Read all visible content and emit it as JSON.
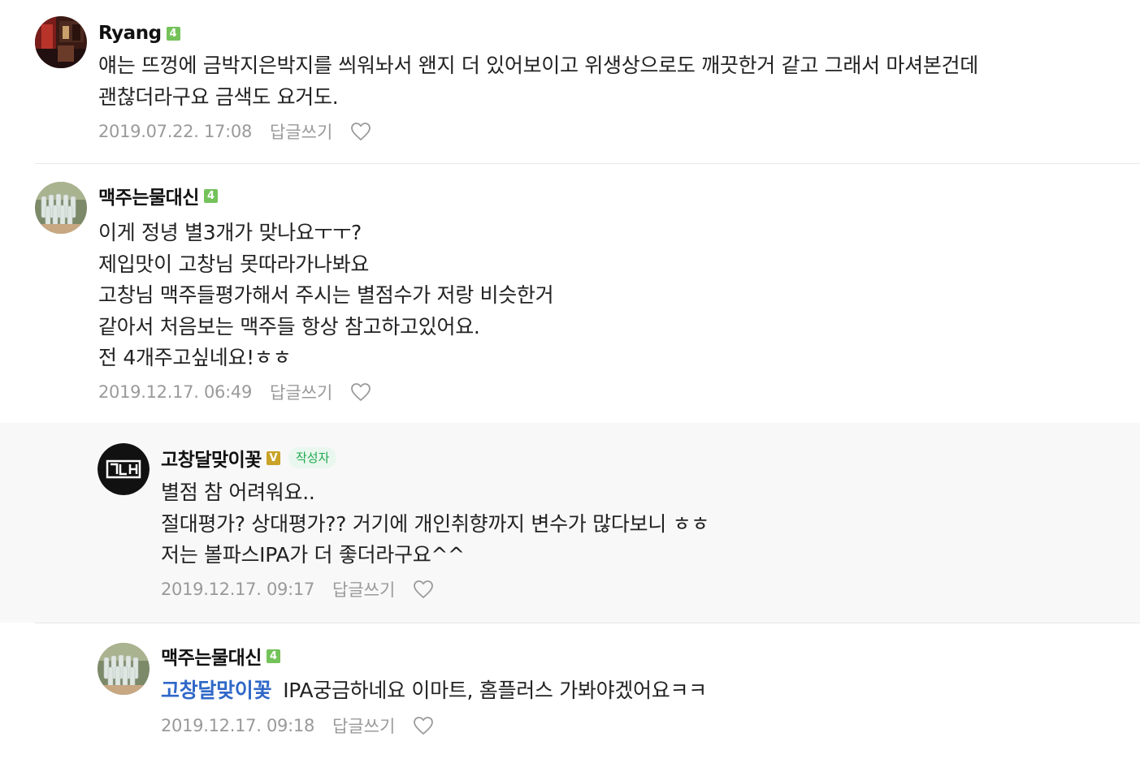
{
  "comments": [
    {
      "nickname": "Ryang",
      "level": "4",
      "lines": [
        "얘는 뜨껑에 금박지은박지를 씌워놔서 왠지 더 있어보이고 위생상으로도 깨끗한거 같고 그래서 마셔본건데",
        "괜찮더라구요 금색도 요거도."
      ],
      "date": "2019.07.22. 17:08",
      "reply_label": "답글쓰기"
    },
    {
      "nickname": "맥주는물대신",
      "level": "4",
      "lines": [
        "이게 정녕 별3개가 맞나요ㅜㅜ?",
        "제입맛이 고창님 못따라가나봐요",
        "고창님 맥주들평가해서 주시는 별점수가 저랑 비슷한거",
        "같아서 처음보는 맥주들 항상 참고하고있어요.",
        "전 4개주고싶네요!ㅎㅎ"
      ],
      "date": "2019.12.17. 06:49",
      "reply_label": "답글쓰기"
    },
    {
      "nickname": "고창달맞이꽃",
      "level": "V",
      "author_tag": "작성자",
      "avatar_text": "고달",
      "lines": [
        "별점 참 어려워요..",
        "절대평가? 상대평가?? 거기에 개인취향까지 변수가 많다보니 ㅎㅎ",
        "저는 볼파스IPA가 더 좋더라구요^^"
      ],
      "date": "2019.12.17. 09:17",
      "reply_label": "답글쓰기"
    },
    {
      "nickname": "맥주는물대신",
      "level": "4",
      "mention": "고창달맞이꽃",
      "lines": [
        "IPA궁금하네요 이마트, 홈플러스 가봐야겠어요ㅋㅋ"
      ],
      "date": "2019.12.17. 09:18",
      "reply_label": "답글쓰기"
    }
  ],
  "colors": {
    "level_badge": "#74c25a",
    "author_badge": "#c9a227",
    "author_tag_text": "#1fa84f",
    "mention": "#2f68c8",
    "meta_text": "#9a9a9a",
    "reply_background": "#f8f8f8"
  },
  "icons": {
    "like": "heart-outline-icon"
  }
}
